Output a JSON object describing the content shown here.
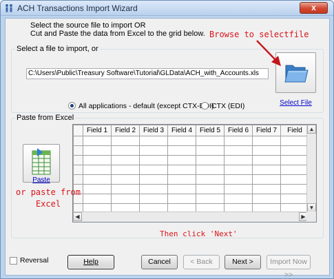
{
  "window": {
    "title": "ACH Transactions Import Wizard",
    "close_glyph": "x"
  },
  "instructions": {
    "line1": "Select the source file to import OR",
    "line2": "Cut and Paste the data from Excel to the grid below."
  },
  "file_group": {
    "label": "Select a file to import, or",
    "path_value": "C:\\Users\\Public\\Treasury Software\\Tutorial\\GLData\\ACH_with_Accounts.xls",
    "select_button_label": "Select File",
    "select_button_icon": "folder-icon",
    "annotation": "Browse to selectfile"
  },
  "format_options": {
    "options": [
      {
        "label": "All applications - default (except CTX-EDI)",
        "checked": true
      },
      {
        "label": "CTX (EDI)",
        "checked": false
      }
    ]
  },
  "paste_group": {
    "label": "Paste from Excel",
    "paste_button_label": "Paste",
    "paste_button_icon": "spreadsheet-paste-icon",
    "annotation_line1": "or paste from",
    "annotation_line2": "Excel",
    "grid_columns": [
      "Field 1",
      "Field 2",
      "Field 3",
      "Field 4",
      "Field 5",
      "Field 6",
      "Field 7",
      "Field"
    ]
  },
  "next_hint": "Then click 'Next'",
  "footer": {
    "reversal_label": "Reversal",
    "reversal_checked": false,
    "help_label": "Help",
    "cancel_label": "Cancel",
    "back_label": "< Back",
    "next_label": "Next >",
    "import_now_label": "Import Now >>"
  },
  "colors": {
    "annotation_red": "#d8141b",
    "link_blue": "#0000cc",
    "title_bar": "#c4d9f1",
    "close_button_red": "#d2472f"
  }
}
